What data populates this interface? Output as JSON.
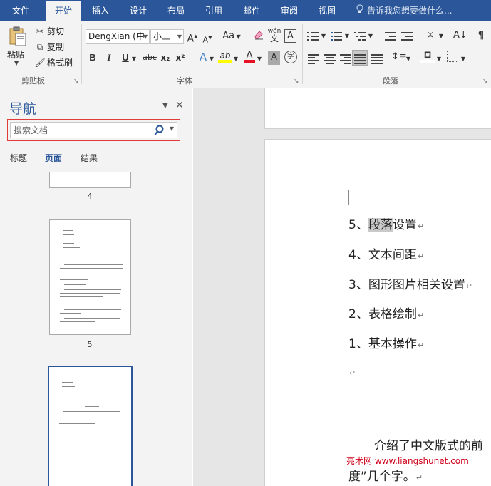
{
  "tabs": [
    {
      "label": "文件",
      "active": false
    },
    {
      "label": "开始",
      "active": true
    },
    {
      "label": "插入",
      "active": false
    },
    {
      "label": "设计",
      "active": false
    },
    {
      "label": "布局",
      "active": false
    },
    {
      "label": "引用",
      "active": false
    },
    {
      "label": "邮件",
      "active": false
    },
    {
      "label": "审阅",
      "active": false
    },
    {
      "label": "视图",
      "active": false
    }
  ],
  "tell_me": "告诉我您想要做什么...",
  "clipboard": {
    "paste": "粘贴",
    "cut": "剪切",
    "copy": "复制",
    "format_painter": "格式刷",
    "label": "剪贴板"
  },
  "font": {
    "name": "DengXian (中",
    "size": "小三",
    "label": "字体",
    "grow": "A",
    "shrink": "A",
    "case": "Aa",
    "phonetic_top": "wén",
    "phonetic_bottom": "文",
    "border_char": "A",
    "bold": "B",
    "italic": "I",
    "underline": "U",
    "strike": "abc",
    "sub": "x₂",
    "sup": "x²",
    "effects": "A",
    "highlight": "ab",
    "color": "A",
    "shading": "A",
    "enclose": "字"
  },
  "paragraph": {
    "label": "段落"
  },
  "colors": {
    "accent": "#2b579a",
    "highlight_yellow": "#ffff00",
    "font_red": "#e81123",
    "search_border": "#e03a3a",
    "watermark": "#d0021b"
  },
  "nav": {
    "title": "导航",
    "search_placeholder": "搜索文档",
    "tabs": [
      "标题",
      "页面",
      "结果"
    ],
    "active_tab": "页面",
    "page_numbers": [
      "4",
      "5"
    ]
  },
  "document": {
    "lines": [
      "5、",
      "段落",
      "设置",
      "4、文本间距",
      "3、图形图片相关设置",
      "2、表格绘制",
      "1、基本操作"
    ],
    "para_text": "介绍了中文版式的前",
    "para_text2": "度”几个字。",
    "paragraph_mark": "↵",
    "watermark": "亮术网 www.liangshunet.com"
  }
}
